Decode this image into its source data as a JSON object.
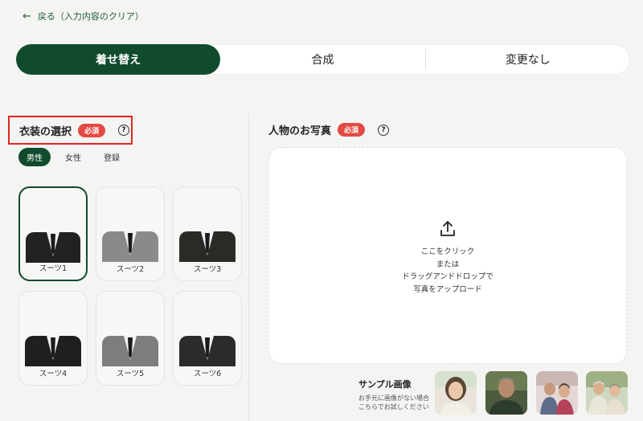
{
  "back": {
    "arrow": "←",
    "label": "戻る（入力内容のクリア）"
  },
  "mode_tabs": [
    {
      "label": "着せ替え",
      "active": true
    },
    {
      "label": "合成",
      "active": false
    },
    {
      "label": "変更なし",
      "active": false
    }
  ],
  "costume": {
    "title": "衣装の選択",
    "required": "必須",
    "help": "?",
    "genders": [
      {
        "label": "男性",
        "active": true
      },
      {
        "label": "女性",
        "active": false
      },
      {
        "label": "登録",
        "active": false
      }
    ],
    "items": [
      {
        "label": "スーツ1",
        "jacket": "#222222",
        "selected": true
      },
      {
        "label": "スーツ2",
        "jacket": "#8a8a8a",
        "selected": false
      },
      {
        "label": "スーツ3",
        "jacket": "#2c2a27",
        "selected": false
      },
      {
        "label": "スーツ4",
        "jacket": "#1f1f22",
        "selected": false
      },
      {
        "label": "スーツ5",
        "jacket": "#7d7d7d",
        "selected": false
      },
      {
        "label": "スーツ6",
        "jacket": "#2b2b2b",
        "selected": false
      }
    ]
  },
  "photo": {
    "title": "人物のお写真",
    "required": "必須",
    "help": "?",
    "upload_lines": [
      "ここをクリック",
      "または",
      "ドラッグアンドドロップで",
      "写真をアップロード"
    ]
  },
  "sample": {
    "title": "サンプル画像",
    "note_line1": "お手元に画像がない場合",
    "note_line2": "こちらでお試しください",
    "thumbnails": [
      "woman",
      "man",
      "couple",
      "elderly-couple"
    ]
  },
  "colors": {
    "accent": "#114b2e",
    "required": "#e24a43",
    "highlight": "#e0261f"
  }
}
